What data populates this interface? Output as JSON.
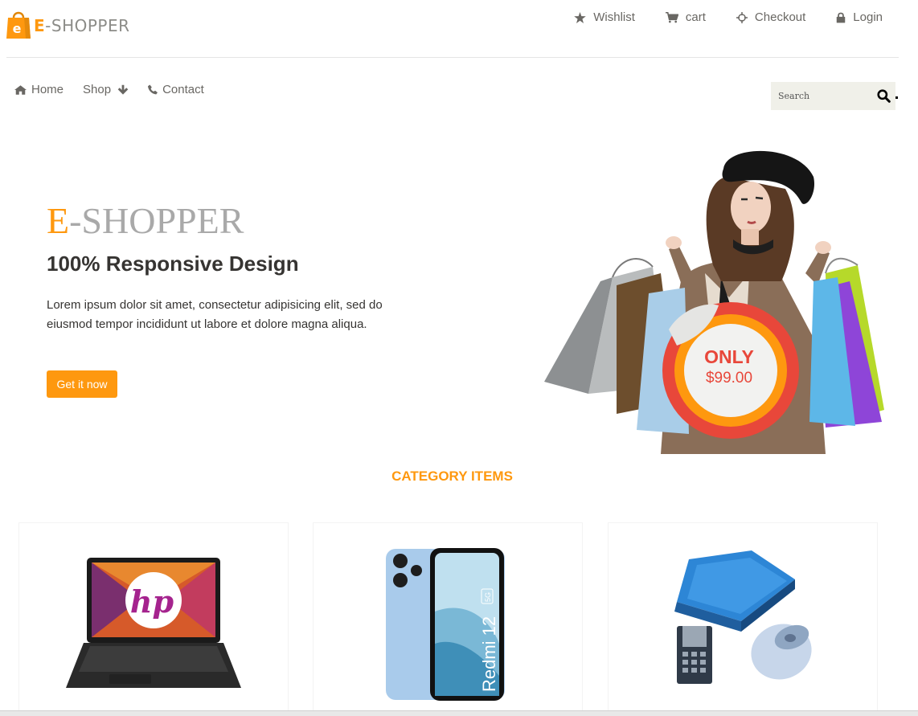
{
  "logo": {
    "letter": "e",
    "brand_prefix": "E",
    "brand_rest": "-SHOPPER"
  },
  "top_links": [
    {
      "label": "Wishlist",
      "icon": "star-icon"
    },
    {
      "label": "cart",
      "icon": "shopping-cart-icon"
    },
    {
      "label": "Checkout",
      "icon": "crosshairs-icon"
    },
    {
      "label": "Login",
      "icon": "lock-icon"
    }
  ],
  "nav": {
    "home": "Home",
    "shop": "Shop",
    "contact": "Contact"
  },
  "search": {
    "placeholder": "Search"
  },
  "hero": {
    "title_prefix": "E",
    "title_rest": "-SHOPPER",
    "subtitle": "100% Responsive Design",
    "description": "Lorem ipsum dolor sit amet, consectetur adipisicing elit, sed do eiusmod tempor incididunt ut labore et dolore magna aliqua.",
    "button": "Get it now",
    "badge_top": "ONLY",
    "badge_price": "$99.00"
  },
  "category": {
    "title": "CATEGORY ITEMS",
    "items": [
      {
        "image": "laptop-image",
        "logo_text": "hp"
      },
      {
        "image": "smartphone-image",
        "model_text": "Redmi 12",
        "network_text": "5G"
      },
      {
        "image": "computer-accessories-image"
      }
    ]
  },
  "colors": {
    "accent": "#FE980F",
    "text_dark": "#363432",
    "text_muted": "#696763",
    "badge_red": "#E8473A"
  }
}
